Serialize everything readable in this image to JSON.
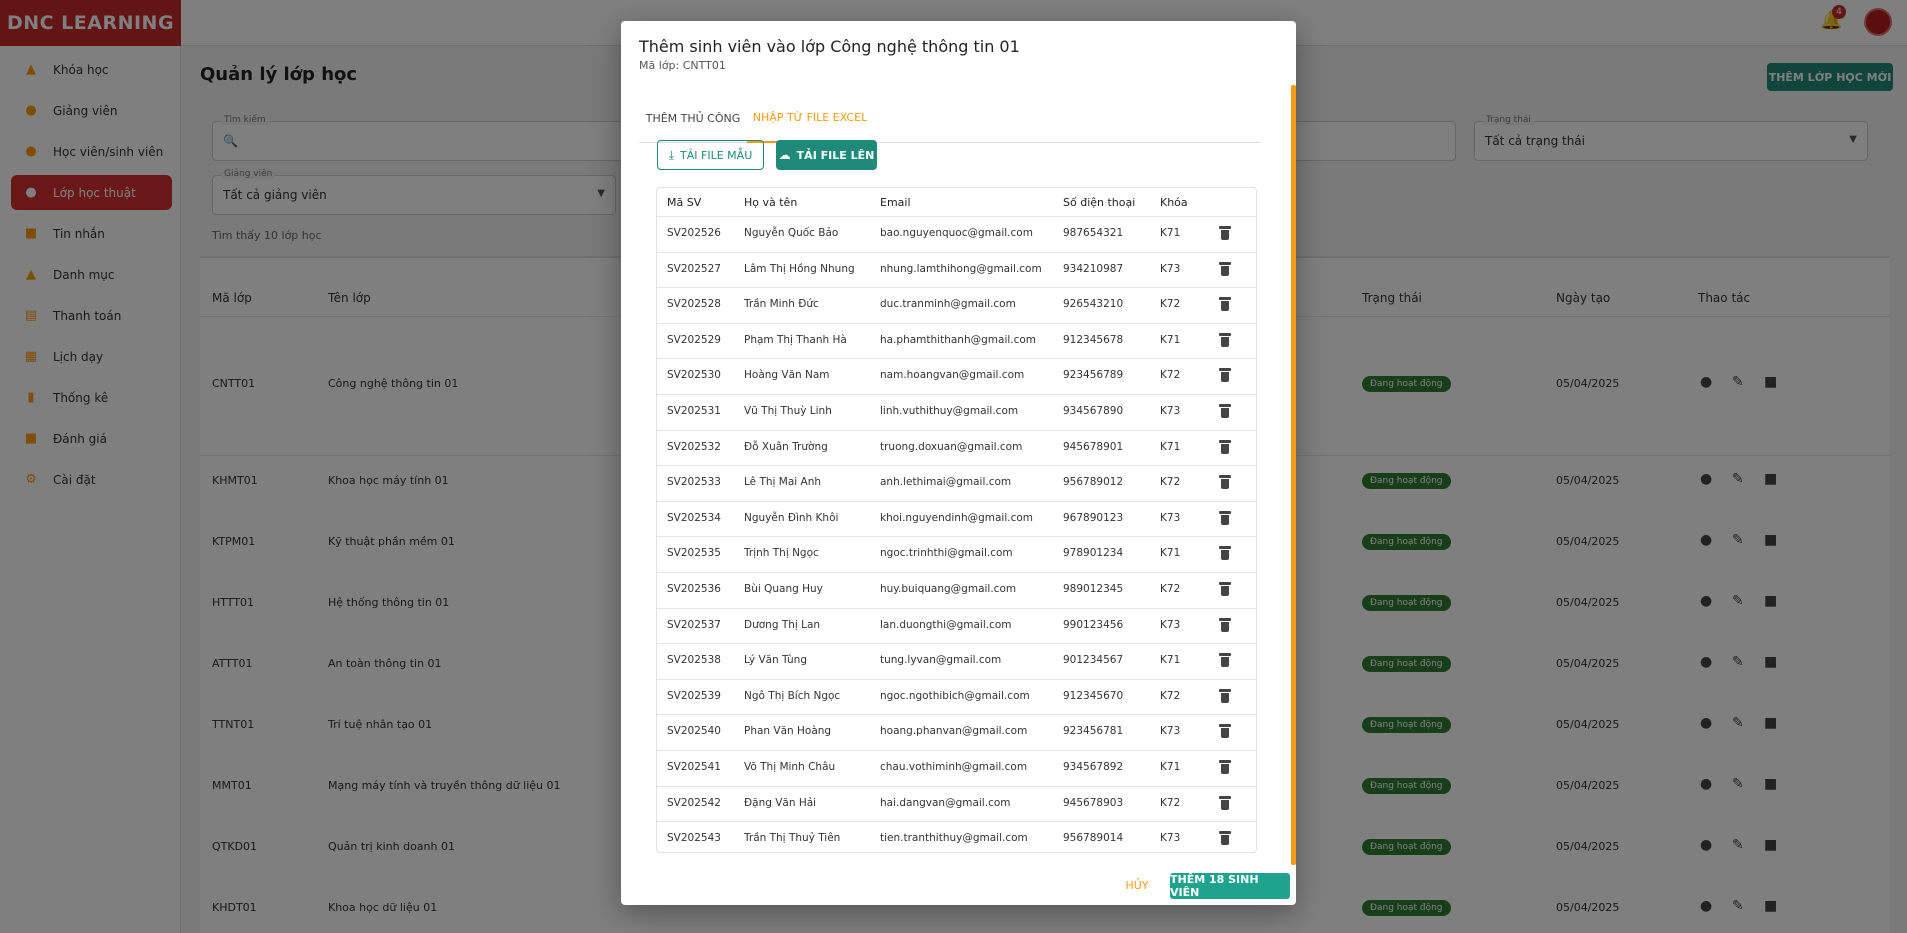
{
  "app": {
    "logo": "DNC LEARNING",
    "notification_count": "4"
  },
  "sidebar": {
    "items": [
      {
        "label": "Khóa học",
        "icon": "school-icon"
      },
      {
        "label": "Giảng viên",
        "icon": "people-icon"
      },
      {
        "label": "Học viên/sinh viên",
        "icon": "people-icon"
      },
      {
        "label": "Lớp học thuật",
        "icon": "class-icon",
        "active": true
      },
      {
        "label": "Tin nhắn",
        "icon": "message-icon"
      },
      {
        "label": "Danh mục",
        "icon": "category-icon"
      },
      {
        "label": "Thanh toán",
        "icon": "payment-icon"
      },
      {
        "label": "Lịch dạy",
        "icon": "calendar-icon"
      },
      {
        "label": "Thống kê",
        "icon": "chart-icon"
      },
      {
        "label": "Đánh giá",
        "icon": "review-icon"
      },
      {
        "label": "Cài đặt",
        "icon": "settings-icon"
      }
    ]
  },
  "main": {
    "title": "Quản lý lớp học",
    "new_class_button": "THÊM LỚP HỌC MỚI",
    "filters": {
      "search_label": "Tìm kiếm",
      "status_label": "Trạng thái",
      "status_value": "Tất cả trạng thái",
      "teacher_label": "Giảng viên",
      "teacher_value": "Tất cả giảng viên"
    },
    "found_text": "Tìm thấy 10 lớp học",
    "table": {
      "headers": {
        "code": "Mã lớp",
        "name": "Tên lớp",
        "status": "Trạng thái",
        "created": "Ngày tạo",
        "actions": "Thao tác"
      },
      "rows": [
        {
          "code": "CNTT01",
          "name": "Công nghệ thông tin 01",
          "status": "Đang hoạt động",
          "created": "05/04/2025"
        },
        {
          "code": "KHMT01",
          "name": "Khoa học máy tính 01",
          "status": "Đang hoạt động",
          "created": "05/04/2025"
        },
        {
          "code": "KTPM01",
          "name": "Kỹ thuật phần mềm 01",
          "status": "Đang hoạt động",
          "created": "05/04/2025"
        },
        {
          "code": "HTTT01",
          "name": "Hệ thống thông tin 01",
          "status": "Đang hoạt động",
          "created": "05/04/2025"
        },
        {
          "code": "ATTT01",
          "name": "An toàn thông tin 01",
          "status": "Đang hoạt động",
          "created": "05/04/2025"
        },
        {
          "code": "TTNT01",
          "name": "Trí tuệ nhân tạo 01",
          "status": "Đang hoạt động",
          "created": "05/04/2025"
        },
        {
          "code": "MMT01",
          "name": "Mạng máy tính và truyền thông dữ liệu 01",
          "status": "Đang hoạt động",
          "created": "05/04/2025"
        },
        {
          "code": "QTKD01",
          "name": "Quản trị kinh doanh 01",
          "status": "Đang hoạt động",
          "created": "05/04/2025"
        },
        {
          "code": "KHDT01",
          "name": "Khoa học dữ liệu 01",
          "status": "Đang hoạt động",
          "created": "05/04/2025"
        }
      ]
    }
  },
  "modal": {
    "title": "Thêm sinh viên vào lớp Công nghệ thông tin 01",
    "subtitle": "Mã lớp: CNTT01",
    "tabs": [
      "THÊM THỦ CÔNG",
      "NHẬP TỪ FILE EXCEL"
    ],
    "active_tab": "NHẬP TỪ FILE EXCEL",
    "download_template_button": "TẢI FILE MẪU",
    "upload_button": "TẢI FILE LÊN",
    "table_headers": {
      "id": "Mã SV",
      "name": "Họ và tên",
      "email": "Email",
      "phone": "Số điện thoại",
      "cohort": "Khóa"
    },
    "students": [
      {
        "id": "SV202526",
        "name": "Nguyễn Quốc Bảo",
        "email": "bao.nguyenquoc@gmail.com",
        "phone": "987654321",
        "cohort": "K71"
      },
      {
        "id": "SV202527",
        "name": "Lâm Thị Hồng Nhung",
        "email": "nhung.lamthihong@gmail.com",
        "phone": "934210987",
        "cohort": "K73"
      },
      {
        "id": "SV202528",
        "name": "Trần Minh Đức",
        "email": "duc.tranminh@gmail.com",
        "phone": "926543210",
        "cohort": "K72"
      },
      {
        "id": "SV202529",
        "name": "Phạm Thị Thanh Hà",
        "email": "ha.phamthithanh@gmail.com",
        "phone": "912345678",
        "cohort": "K71"
      },
      {
        "id": "SV202530",
        "name": "Hoàng Văn Nam",
        "email": "nam.hoangvan@gmail.com",
        "phone": "923456789",
        "cohort": "K72"
      },
      {
        "id": "SV202531",
        "name": "Vũ Thị Thuỳ Linh",
        "email": "linh.vuthithuy@gmail.com",
        "phone": "934567890",
        "cohort": "K73"
      },
      {
        "id": "SV202532",
        "name": "Đỗ Xuân Trường",
        "email": "truong.doxuan@gmail.com",
        "phone": "945678901",
        "cohort": "K71"
      },
      {
        "id": "SV202533",
        "name": "Lê Thị Mai Anh",
        "email": "anh.lethimai@gmail.com",
        "phone": "956789012",
        "cohort": "K72"
      },
      {
        "id": "SV202534",
        "name": "Nguyễn Đình Khôi",
        "email": "khoi.nguyendinh@gmail.com",
        "phone": "967890123",
        "cohort": "K73"
      },
      {
        "id": "SV202535",
        "name": "Trịnh Thị Ngọc",
        "email": "ngoc.trinhthi@gmail.com",
        "phone": "978901234",
        "cohort": "K71"
      },
      {
        "id": "SV202536",
        "name": "Bùi Quang Huy",
        "email": "huy.buiquang@gmail.com",
        "phone": "989012345",
        "cohort": "K72"
      },
      {
        "id": "SV202537",
        "name": "Dương Thị Lan",
        "email": "lan.duongthi@gmail.com",
        "phone": "990123456",
        "cohort": "K73"
      },
      {
        "id": "SV202538",
        "name": "Lý Văn Tùng",
        "email": "tung.lyvan@gmail.com",
        "phone": "901234567",
        "cohort": "K71"
      },
      {
        "id": "SV202539",
        "name": "Ngô Thị Bích Ngọc",
        "email": "ngoc.ngothibich@gmail.com",
        "phone": "912345670",
        "cohort": "K72"
      },
      {
        "id": "SV202540",
        "name": "Phan Văn Hoàng",
        "email": "hoang.phanvan@gmail.com",
        "phone": "923456781",
        "cohort": "K73"
      },
      {
        "id": "SV202541",
        "name": "Võ Thị Minh Châu",
        "email": "chau.vothiminh@gmail.com",
        "phone": "934567892",
        "cohort": "K71"
      },
      {
        "id": "SV202542",
        "name": "Đặng Văn Hải",
        "email": "hai.dangvan@gmail.com",
        "phone": "945678903",
        "cohort": "K72"
      },
      {
        "id": "SV202543",
        "name": "Trần Thị Thuỷ Tiên",
        "email": "tien.tranthithuy@gmail.com",
        "phone": "956789014",
        "cohort": "K73"
      }
    ],
    "cancel_button": "HỦY",
    "submit_button": "THÊM 18 SINH VIÊN"
  },
  "colors": {
    "brand_red": "#c62828",
    "accent_teal": "#1f8a7a",
    "accent_orange": "#f39c12",
    "status_green": "#2e7d32"
  }
}
